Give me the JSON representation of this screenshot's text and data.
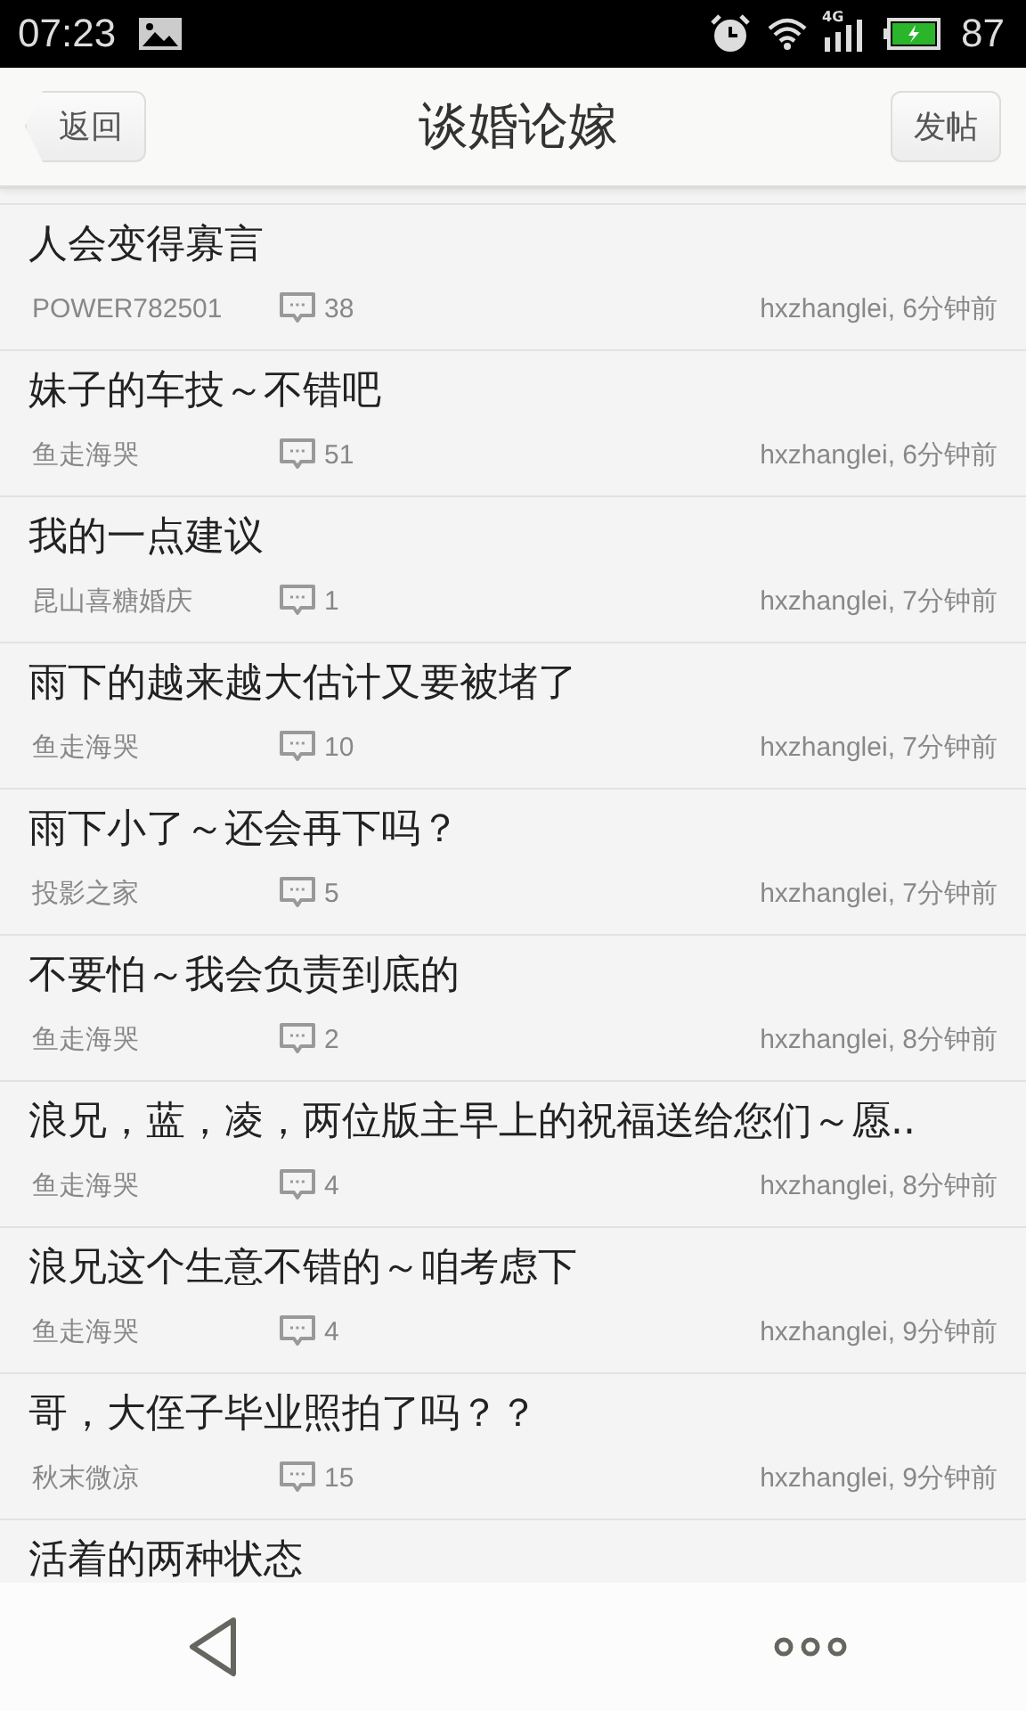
{
  "status_bar": {
    "time": "07:23",
    "network": "4G",
    "battery": "87"
  },
  "header": {
    "back": "返回",
    "title": "谈婚论嫁",
    "post": "发帖"
  },
  "posts": [
    {
      "title": "人会变得寡言",
      "author": "POWER782501",
      "replies": "38",
      "last": "hxzhanglei, 6分钟前"
    },
    {
      "title": "妹子的车技～不错吧",
      "author": "鱼走海哭",
      "replies": "51",
      "last": "hxzhanglei, 6分钟前"
    },
    {
      "title": "我的一点建议",
      "author": "昆山喜糖婚庆",
      "replies": "1",
      "last": "hxzhanglei, 7分钟前"
    },
    {
      "title": "雨下的越来越大估计又要被堵了",
      "author": "鱼走海哭",
      "replies": "10",
      "last": "hxzhanglei, 7分钟前"
    },
    {
      "title": "雨下小了～还会再下吗？",
      "author": "投影之家",
      "replies": "5",
      "last": "hxzhanglei, 7分钟前"
    },
    {
      "title": "不要怕～我会负责到底的",
      "author": "鱼走海哭",
      "replies": "2",
      "last": "hxzhanglei, 8分钟前"
    },
    {
      "title": "浪兄，蓝，凌，两位版主早上的祝福送给您们～愿..",
      "author": "鱼走海哭",
      "replies": "4",
      "last": "hxzhanglei, 8分钟前"
    },
    {
      "title": "浪兄这个生意不错的～咱考虑下",
      "author": "鱼走海哭",
      "replies": "4",
      "last": "hxzhanglei, 9分钟前"
    },
    {
      "title": "哥，大侄子毕业照拍了吗？？",
      "author": "秋末微凉",
      "replies": "15",
      "last": "hxzhanglei, 9分钟前"
    },
    {
      "title": "活着的两种状态"
    }
  ]
}
